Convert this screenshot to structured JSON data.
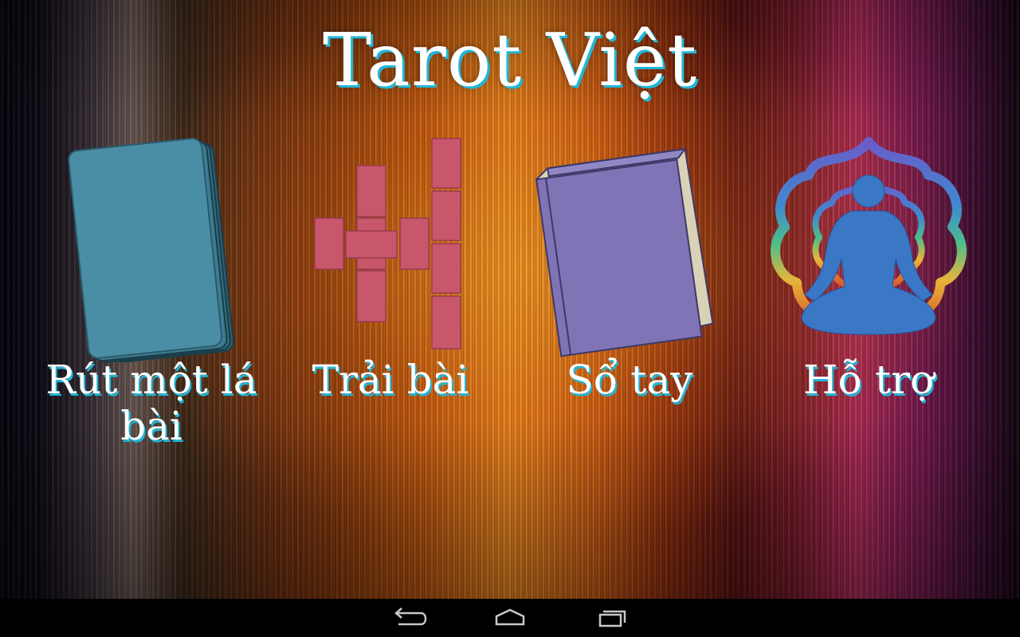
{
  "app": {
    "title": "Tarot Việt"
  },
  "menu": {
    "items": [
      {
        "label": "Rút một lá bài",
        "icon": "tarot-card-deck-icon",
        "color": "#4a8ea5"
      },
      {
        "label": "Trải bài",
        "icon": "card-spread-icon",
        "color": "#c9576c"
      },
      {
        "label": "Sổ tay",
        "icon": "book-icon",
        "color": "#8074b6"
      },
      {
        "label": "Hỗ trợ",
        "icon": "meditation-lotus-icon",
        "color": "#3a78c6"
      }
    ]
  },
  "navigation_bar": {
    "buttons": [
      {
        "icon": "back-icon"
      },
      {
        "icon": "home-icon"
      },
      {
        "icon": "recent-apps-icon"
      }
    ]
  },
  "colors": {
    "title_shadow": "#1fb7d8",
    "navbar": "#000000"
  }
}
